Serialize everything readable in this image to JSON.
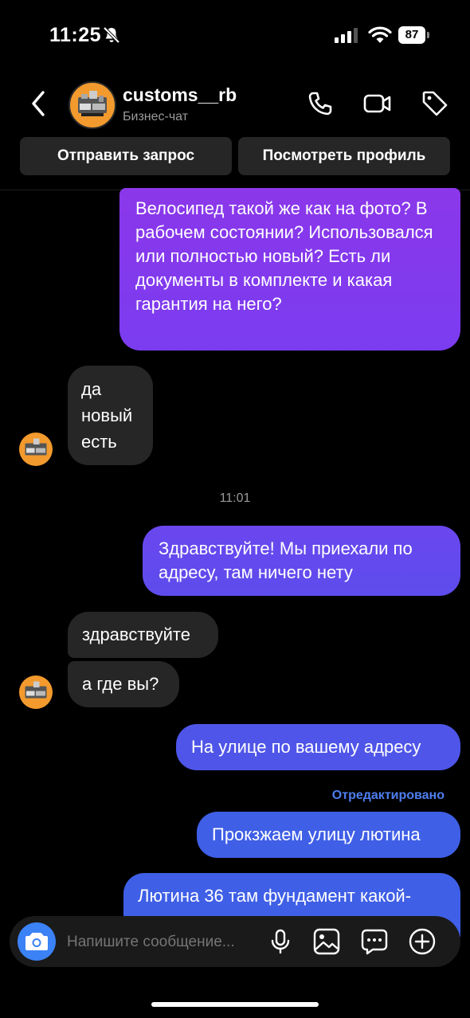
{
  "status_bar": {
    "time": "11:25",
    "battery": "87"
  },
  "header": {
    "name": "customs__rb",
    "subtitle": "Бизнес-чат",
    "btn_request": "Отправить запрос",
    "btn_profile": "Посмотреть профиль"
  },
  "messages": {
    "m1": "Велосипед такой же как на фото? В рабочем состоянии? Использовался или полностью новый? Есть ли документы в комплекте и какая гарантия на него?",
    "m2_l1": "да",
    "m2_l2": "новый",
    "m2_l3": "есть",
    "timestamp": "11:01",
    "m3": "Здравствуйте! Мы приехали по адресу, там ничего нету",
    "m4": "здравствуйте",
    "m5": "а где вы?",
    "m6": "На улице по вашему адресу",
    "edited": "Отредактировано",
    "m7": "Прокзжаем улицу лютина",
    "m8": "Лютина 36 там фундамент какой-"
  },
  "composer": {
    "placeholder": "Напишите сообщение..."
  },
  "icons": [
    "chevron-left-icon",
    "phone-icon",
    "video-icon",
    "tag-icon",
    "camera-icon",
    "microphone-icon",
    "gallery-icon",
    "sticker-icon",
    "plus-icon"
  ],
  "colors": {
    "incoming": "#262626",
    "outgoing_top": "#8b37ea",
    "outgoing_bottom": "#3f5fe6",
    "edited": "#4f7ff0",
    "camera": "#3b82f6"
  }
}
